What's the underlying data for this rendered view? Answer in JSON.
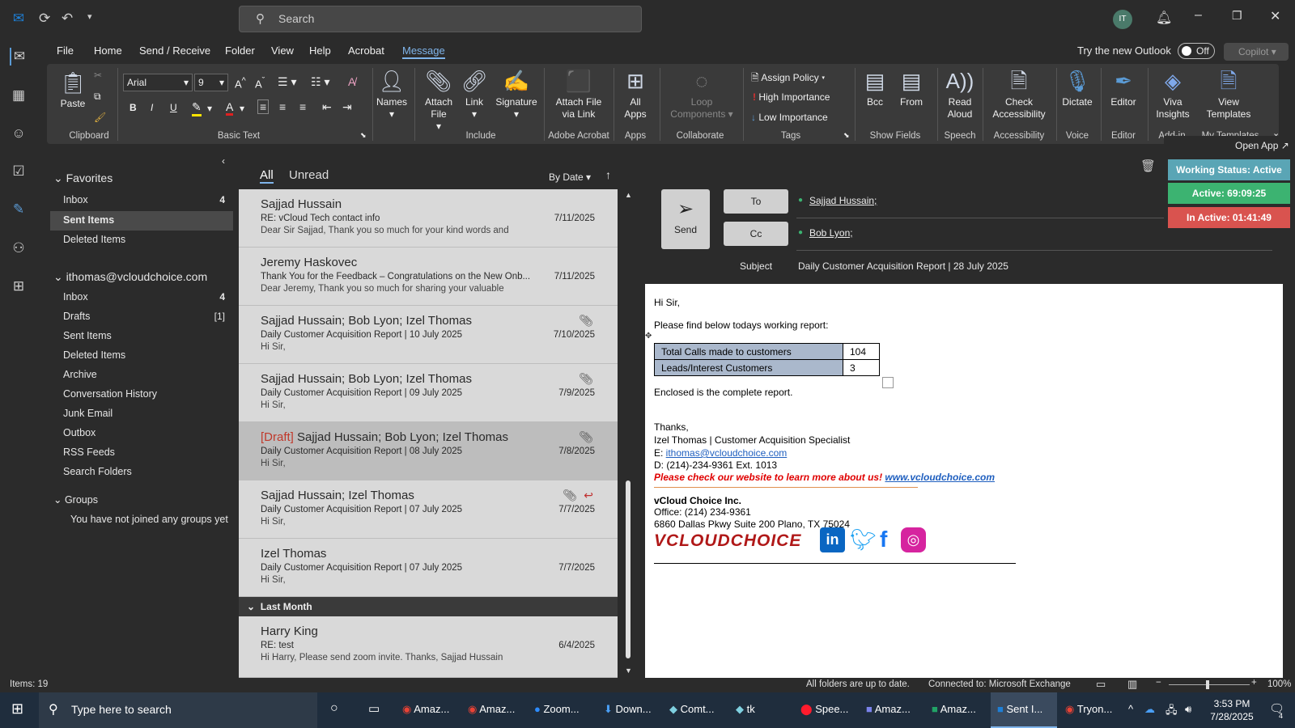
{
  "titlebar": {
    "search_placeholder": "Search",
    "avatar_initials": "IT"
  },
  "menu": [
    "File",
    "Home",
    "Send / Receive",
    "Folder",
    "View",
    "Help",
    "Acrobat",
    "Message"
  ],
  "try_new_outlook": "Try the new Outlook",
  "toggle_label": "Off",
  "copilot_label": "Copilot",
  "ribbon": {
    "paste": "Paste",
    "clipboard_group": "Clipboard",
    "font_name": "Arial",
    "font_size": "9",
    "basic_text_group": "Basic Text",
    "names": "Names",
    "attach_file": "Attach File",
    "link": "Link",
    "signature": "Signature",
    "include_group": "Include",
    "attach_link_l1": "Attach File",
    "attach_link_l2": "via Link",
    "adobe_group": "Adobe Acrobat",
    "all_apps_l1": "All",
    "all_apps_l2": "Apps",
    "apps_group": "Apps",
    "loop_l1": "Loop",
    "loop_l2": "Components",
    "collaborate_group": "Collaborate",
    "assign_policy": "Assign Policy",
    "high_importance": "High Importance",
    "low_importance": "Low Importance",
    "tags_group": "Tags",
    "bcc": "Bcc",
    "from": "From",
    "show_fields_group": "Show Fields",
    "read_aloud_l1": "Read",
    "read_aloud_l2": "Aloud",
    "speech_group": "Speech",
    "check_acc_l1": "Check",
    "check_acc_l2": "Accessibility",
    "accessibility_group": "Accessibility",
    "dictate": "Dictate",
    "voice_group": "Voice",
    "editor": "Editor",
    "editor_group": "Editor",
    "viva_l1": "Viva",
    "viva_l2": "Insights",
    "addin_group": "Add-in",
    "view_templates_l1": "View",
    "view_templates_l2": "Templates",
    "templates_group": "My Templates"
  },
  "folders": {
    "favorites": "Favorites",
    "fav_items": [
      {
        "label": "Inbox",
        "count": "4"
      },
      {
        "label": "Sent Items",
        "count": ""
      },
      {
        "label": "Deleted Items",
        "count": ""
      }
    ],
    "account": "ithomas@vcloudchoice.com",
    "acct_items": [
      {
        "label": "Inbox",
        "count": "4"
      },
      {
        "label": "Drafts",
        "count": "[1]"
      },
      {
        "label": "Sent Items",
        "count": ""
      },
      {
        "label": "Deleted Items",
        "count": ""
      },
      {
        "label": "Archive",
        "count": ""
      },
      {
        "label": "Conversation History",
        "count": ""
      },
      {
        "label": "Junk Email",
        "count": ""
      },
      {
        "label": "Outbox",
        "count": ""
      },
      {
        "label": "RSS Feeds",
        "count": ""
      },
      {
        "label": "Search Folders",
        "count": ""
      }
    ],
    "groups": "Groups",
    "groups_note": "You have not joined any groups yet"
  },
  "list": {
    "tab_all": "All",
    "tab_unread": "Unread",
    "sort": "By Date",
    "section_last_month": "Last Month",
    "messages": [
      {
        "draft": "",
        "from": "Sajjad Hussain",
        "subject": "RE: vCloud Tech contact info",
        "preview": "Dear Sir Sajjad,  Thank you so much for your kind words and",
        "date": "7/11/2025"
      },
      {
        "draft": "",
        "from": "Jeremy Haskovec",
        "subject": "Thank You for the Feedback – Congratulations on the New Onb...",
        "preview": "Dear Jeremy,  Thank you so much for sharing your valuable",
        "date": "7/11/2025"
      },
      {
        "draft": "",
        "from": "Sajjad Hussain; Bob Lyon; Izel Thomas",
        "subject": "Daily Customer Acquisition Report | 10 July 2025",
        "preview": "Hi Sir,",
        "date": "7/10/2025"
      },
      {
        "draft": "",
        "from": "Sajjad Hussain; Bob Lyon; Izel Thomas",
        "subject": "Daily Customer Acquisition Report | 09 July 2025",
        "preview": "Hi Sir,",
        "date": "7/9/2025"
      },
      {
        "draft": "[Draft]",
        "from": "Sajjad Hussain; Bob Lyon; Izel Thomas",
        "subject": "Daily Customer Acquisition Report | 08 July 2025",
        "preview": "Hi Sir,",
        "date": "7/8/2025"
      },
      {
        "draft": "",
        "from": "Sajjad Hussain; Izel Thomas",
        "subject": "Daily Customer Acquisition Report | 07 July 2025",
        "preview": "Hi Sir,",
        "date": "7/7/2025"
      },
      {
        "draft": "",
        "from": "Izel Thomas",
        "subject": "Daily Customer Acquisition Report | 07 July 2025",
        "preview": "Hi Sir,",
        "date": "7/7/2025"
      },
      {
        "draft": "",
        "from": "Harry King",
        "subject": "RE: test",
        "preview": "Hi Harry,   Please send zoom invite.   Thanks,  Sajjad Hussain",
        "date": "6/4/2025"
      }
    ]
  },
  "compose": {
    "send": "Send",
    "to_btn": "To",
    "cc_btn": "Cc",
    "to_value": "Sajjad Hussain;",
    "cc_value": "Bob Lyon;",
    "subject_label": "Subject",
    "subject_value": "Daily Customer Acquisition Report | 28 July 2025"
  },
  "email": {
    "greeting": "Hi Sir,",
    "intro": "Please find below todays working report:",
    "table": [
      {
        "label": "Total Calls made to customers",
        "value": "104"
      },
      {
        "label": "Leads/Interest Customers",
        "value": "3"
      }
    ],
    "enclosed": "Enclosed is the complete report.",
    "thanks": "Thanks,",
    "sig_name": "Izel Thomas | Customer Acquisition Specialist",
    "sig_email_prefix": "E: ",
    "sig_email": "ithomas@vcloudchoice.com",
    "sig_phone": "D: (214)-234-9361 Ext. 1013",
    "promo": "Please check our website to learn more about us! ",
    "website": "www.vcloudchoice.com",
    "company": "vCloud Choice Inc.",
    "office": "Office: (214) 234-9361",
    "address": "6860 Dallas Pkwy Suite 200 Plano, TX 75024",
    "logo_text": "VCLOUDCHOICE"
  },
  "working_status": {
    "open_app": "Open App",
    "status": "Working Status: Active",
    "active": "Active: 69:09:25",
    "inactive": "In Active: 01:41:49"
  },
  "statusbar": {
    "items": "Items: 19",
    "sync": "All folders are up to date.",
    "connection": "Connected to: Microsoft Exchange",
    "zoom": "100%"
  },
  "taskbar": {
    "search_placeholder": "Type here to search",
    "apps": [
      "Amaz...",
      "Amaz...",
      "Zoom...",
      "Down...",
      "Comt...",
      "tk",
      "Spee...",
      "Amaz...",
      "Amaz...",
      "Sent I...",
      "Tryon..."
    ],
    "time": "3:53 PM",
    "date": "7/28/2025",
    "notif_count": "4"
  },
  "colors": {
    "accent": "#5b9bd5",
    "active": "#3cb371",
    "inactive": "#d9534f",
    "status": "#5aa5b5"
  }
}
